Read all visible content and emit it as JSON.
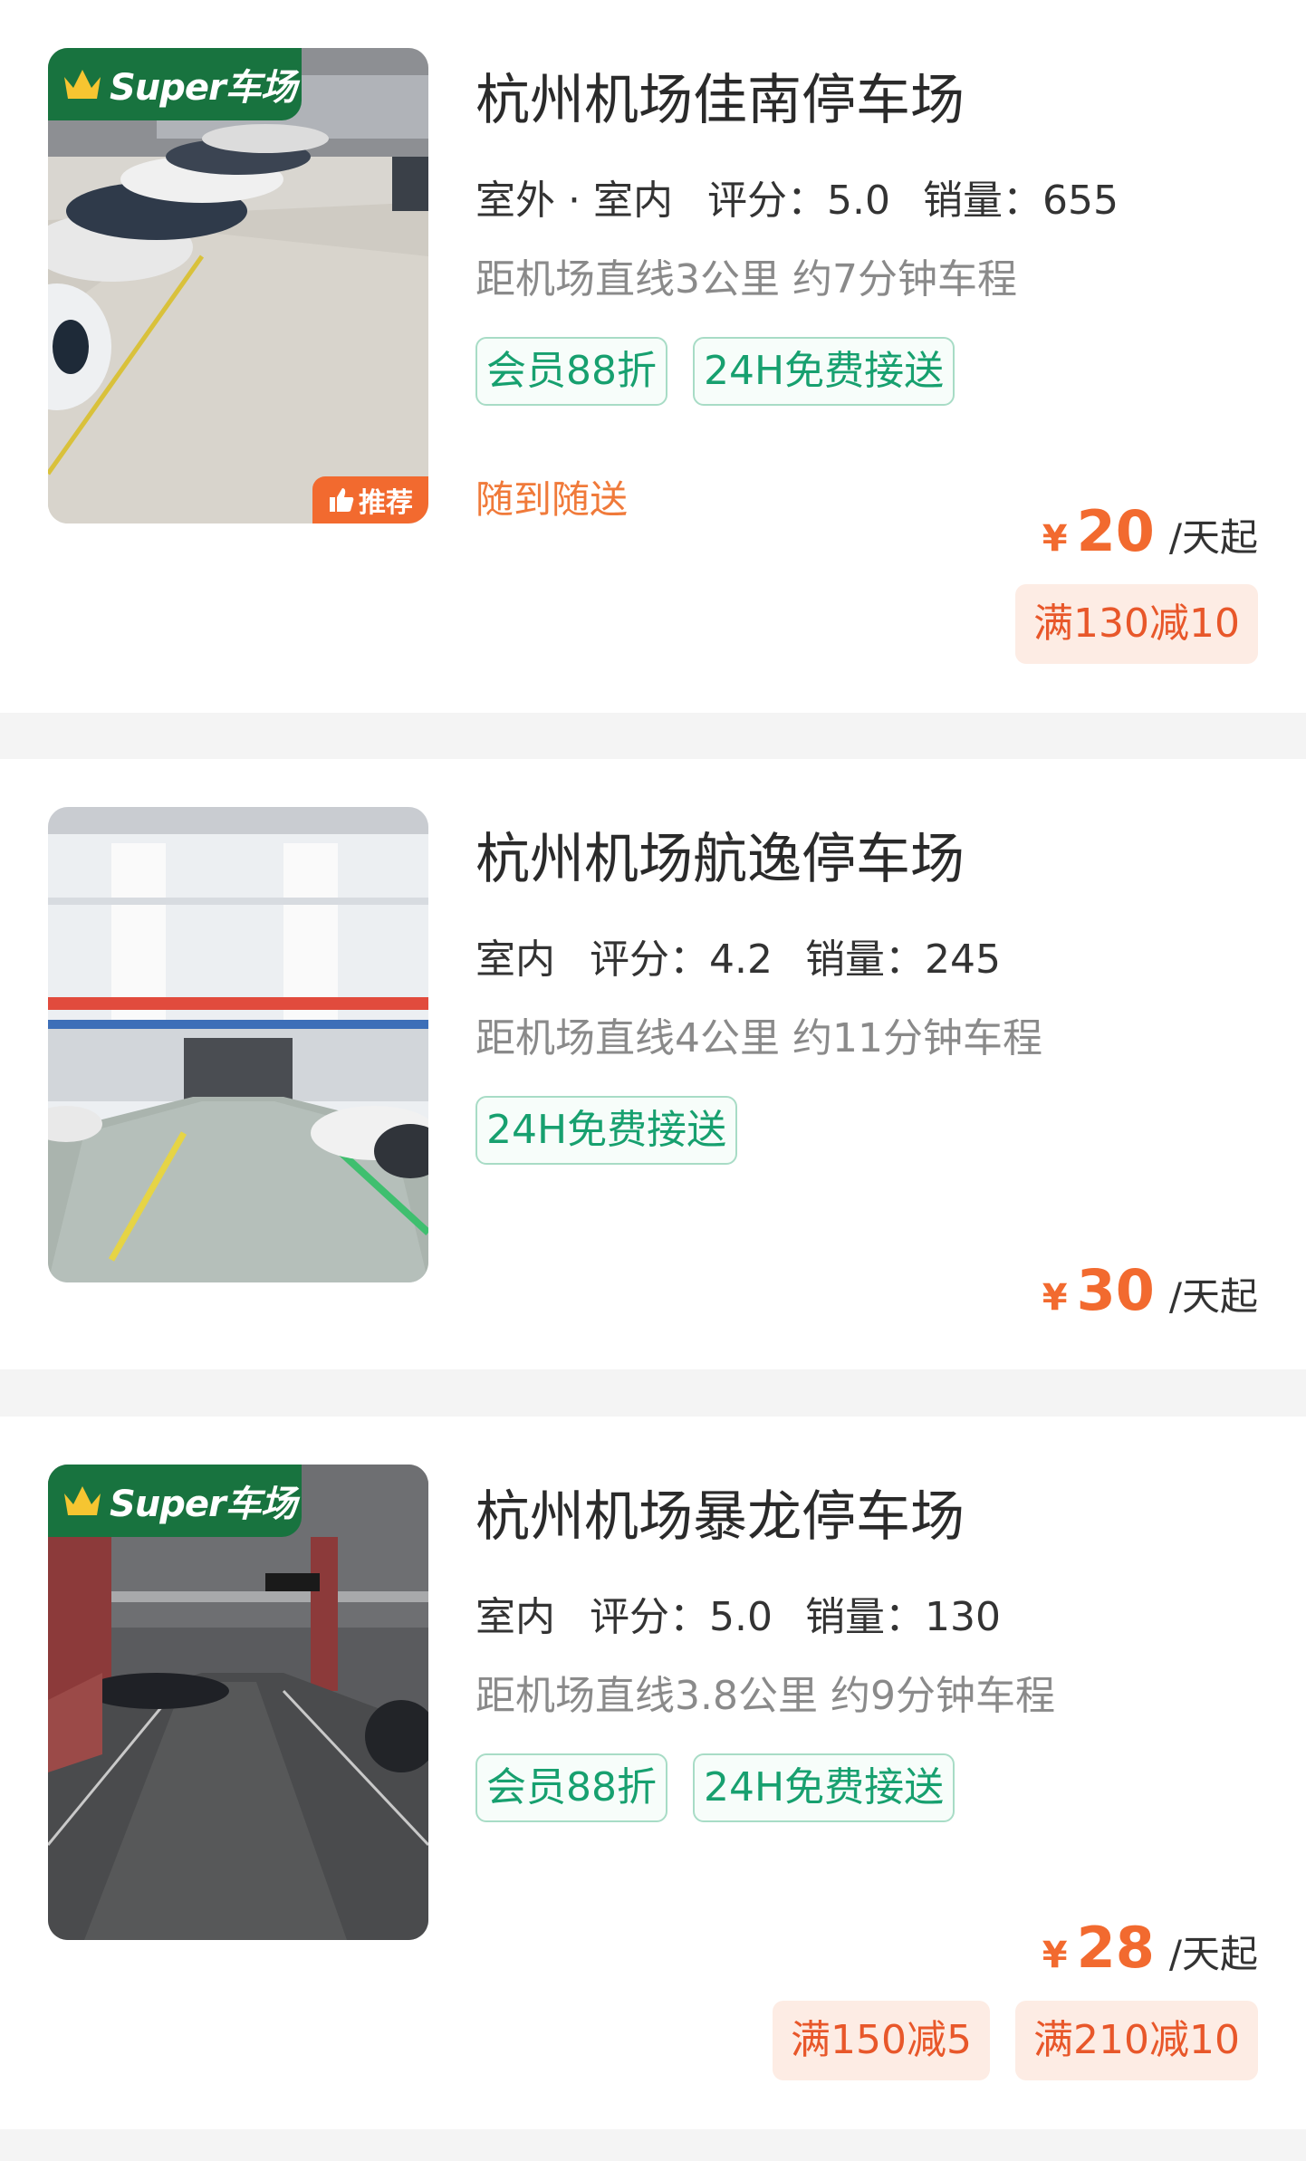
{
  "listings": [
    {
      "title": "杭州机场佳南停车场",
      "env": "室外 · 室内",
      "rating": "评分：5.0",
      "sales": "销量：655",
      "distance": "距机场直线3公里 约7分钟车程",
      "tags": [
        "会员88折",
        "24H免费接送"
      ],
      "note": "随到随送",
      "badge": "Super车场",
      "recommend": "推荐",
      "price_symbol": "¥",
      "price": "20",
      "price_unit": "/天起",
      "coupons": [
        "满130减10"
      ]
    },
    {
      "title": "杭州机场航逸停车场",
      "env": "室内",
      "rating": "评分：4.2",
      "sales": "销量：245",
      "distance": "距机场直线4公里 约11分钟车程",
      "tags": [
        "24H免费接送"
      ],
      "price_symbol": "¥",
      "price": "30",
      "price_unit": "/天起"
    },
    {
      "title": "杭州机场暴龙停车场",
      "env": "室内",
      "rating": "评分：5.0",
      "sales": "销量：130",
      "distance": "距机场直线3.8公里 约9分钟车程",
      "tags": [
        "会员88折",
        "24H免费接送"
      ],
      "badge": "Super车场",
      "price_symbol": "¥",
      "price": "28",
      "price_unit": "/天起",
      "coupons": [
        "满150减5",
        "满210减10"
      ]
    }
  ],
  "colors": {
    "accent_orange": "#f26a2f",
    "tag_green": "#17a06f",
    "badge_green": "#18733f",
    "coupon_bg": "#fdece4"
  }
}
